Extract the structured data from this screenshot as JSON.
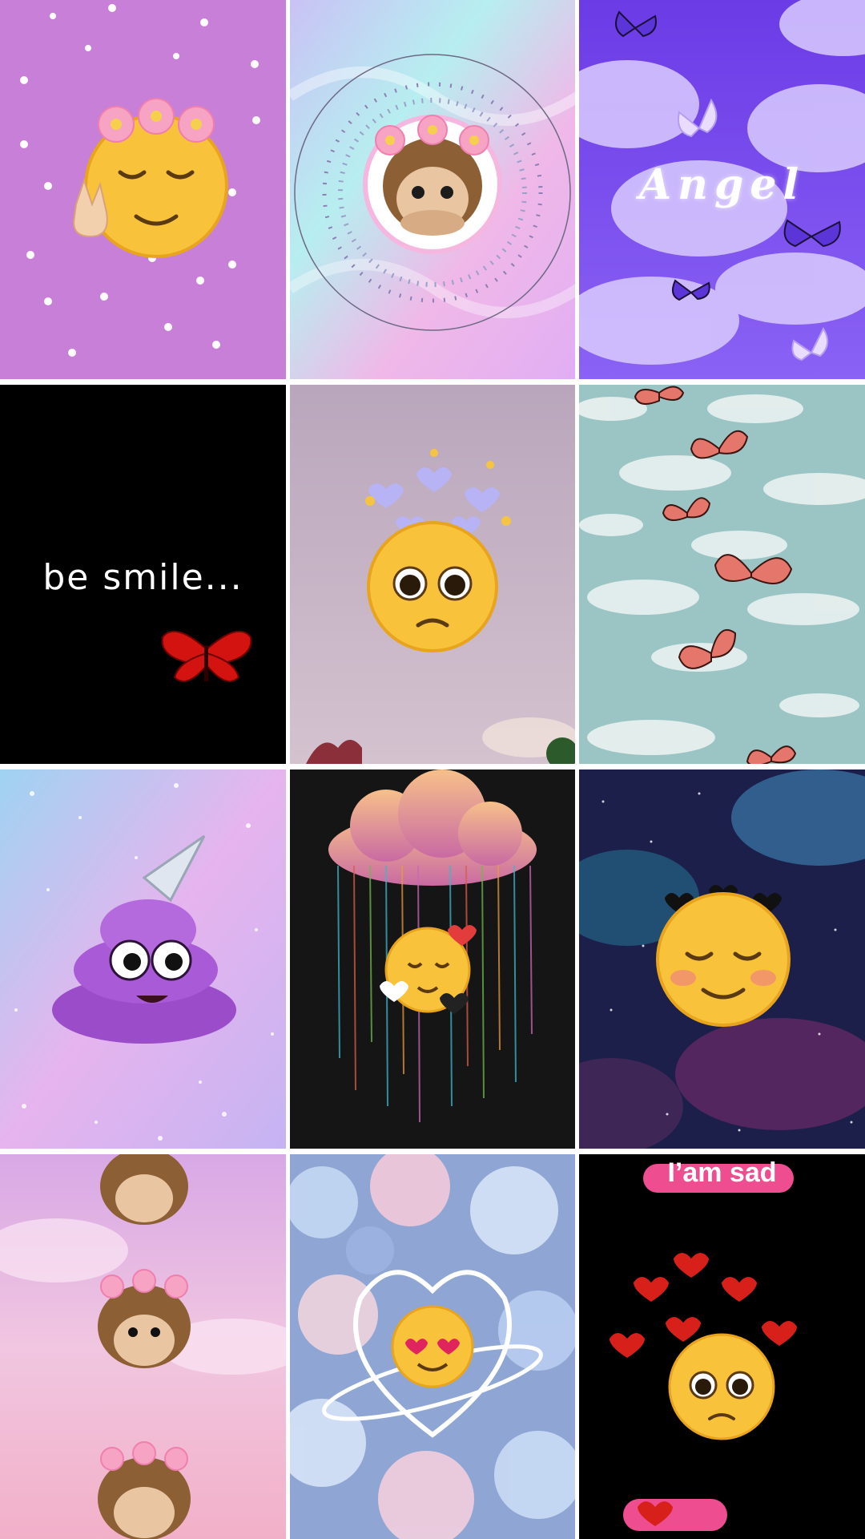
{
  "gallery": {
    "tiles": [
      {
        "id": "emoji-flower-crown",
        "caption": ""
      },
      {
        "id": "monkey-holographic",
        "caption": ""
      },
      {
        "id": "angel-butterflies",
        "caption": "Angel"
      },
      {
        "id": "be-smile-black",
        "caption": "be  smile..."
      },
      {
        "id": "pleading-hearts",
        "caption": ""
      },
      {
        "id": "pink-butterflies-sky",
        "caption": ""
      },
      {
        "id": "unicorn-poop",
        "caption": ""
      },
      {
        "id": "rain-cloud-emoji",
        "caption": ""
      },
      {
        "id": "galaxy-blush-emoji",
        "caption": ""
      },
      {
        "id": "monkeys-pink-sky",
        "caption": ""
      },
      {
        "id": "heart-in-love-flowers",
        "caption": ""
      },
      {
        "id": "iam-sad",
        "caption": "I’am sad"
      }
    ]
  },
  "colors": {
    "background": "#ffffff",
    "lilac": "#c87fd8",
    "angel_purple": "#7a4cf0",
    "mint_sky": "#9ac5c4",
    "galaxy_navy": "#1b1f4a",
    "sad_pink": "#ee4d8f"
  }
}
